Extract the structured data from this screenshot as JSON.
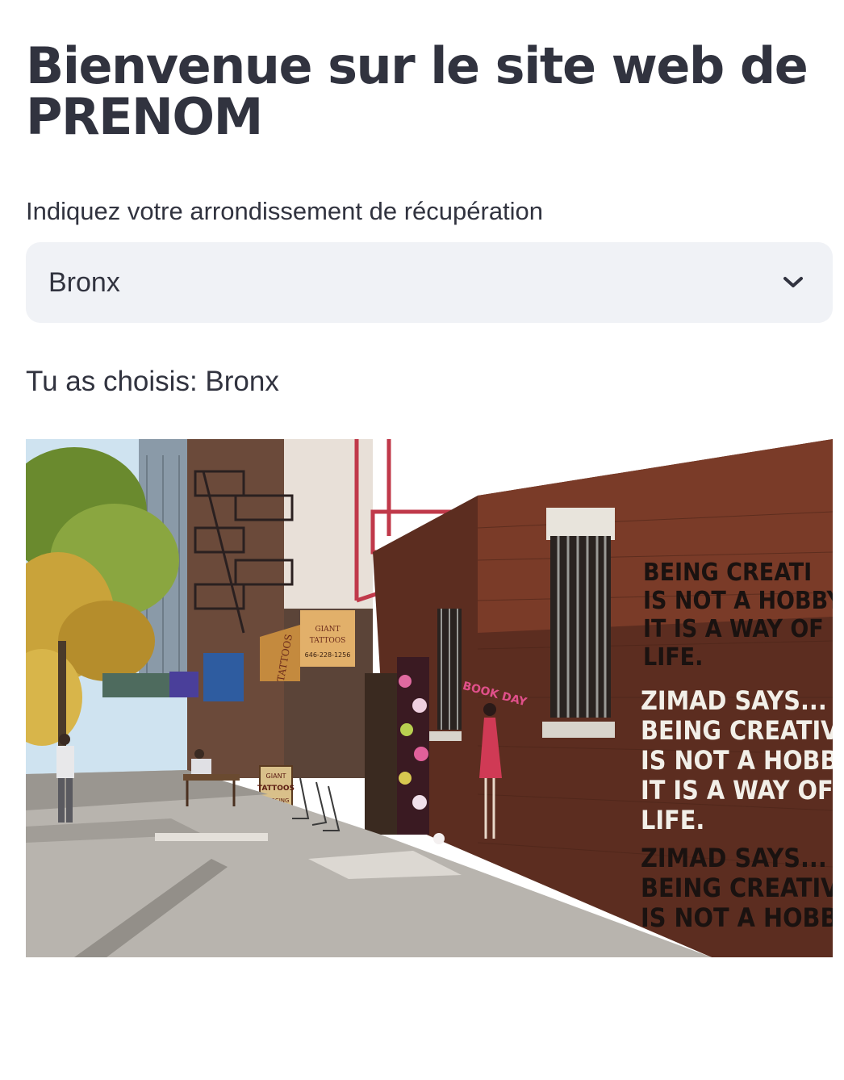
{
  "header": {
    "title": "Bienvenue sur le site web de PRENOM"
  },
  "select": {
    "label": "Indiquez votre arrondissement de récupération",
    "value": "Bronx",
    "chevron_icon": "chevron-down-icon"
  },
  "result": {
    "text": "Tu as choisis: Bronx"
  },
  "photo": {
    "shop_sign_line1": "GIANT",
    "shop_sign_line2": "TATTOOS",
    "shop_sign_phone": "646-228-1256",
    "side_sign": "TATTOOS",
    "sidewalk_sign_line1": "GIANT",
    "sidewalk_sign_line2": "TATTOOS",
    "sidewalk_sign_line3": "PIERCING",
    "mural_tag": "BOOK DAY",
    "wall_text_top": [
      "BEING CREATI",
      "IS NOT A HOBBY.",
      "IT IS A WAY OF",
      "LIFE."
    ],
    "wall_text_mid": [
      "ZIMAD SAYS...",
      "BEING CREATIVE",
      "IS NOT A HOBBY.",
      "IT IS A WAY OF",
      "LIFE."
    ],
    "wall_text_bot": [
      "ZIMAD SAYS...",
      "BEING CREATIVE",
      "IS NOT A HOBBY."
    ]
  }
}
